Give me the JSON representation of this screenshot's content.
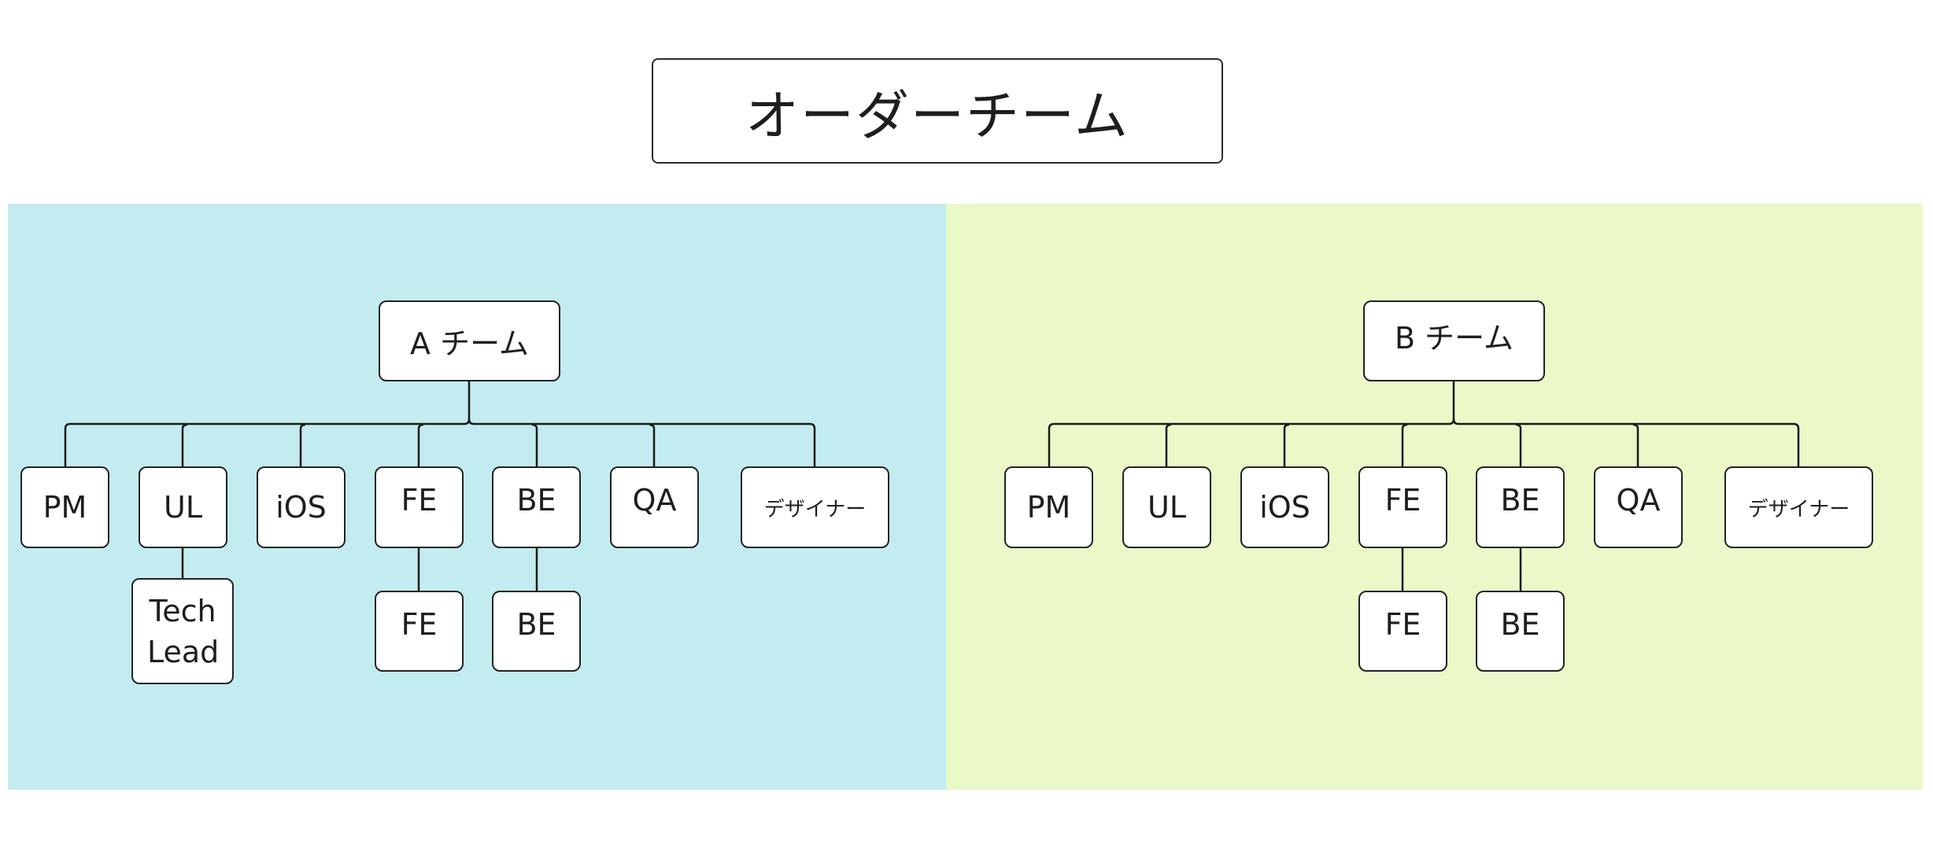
{
  "title": "オーダーチーム",
  "colors": {
    "team_a_bg": "#c3ecf0",
    "team_b_bg": "#ebf8c8",
    "node_border": "#222222",
    "line": "#1a1a1a"
  },
  "teams": [
    {
      "name": "A チーム",
      "members": [
        {
          "label": "PM"
        },
        {
          "label": "UL",
          "children": [
            "Tech Lead"
          ]
        },
        {
          "label": "iOS"
        },
        {
          "label": "FE",
          "children": [
            "FE"
          ]
        },
        {
          "label": "BE",
          "children": [
            "BE"
          ]
        },
        {
          "label": "QA"
        },
        {
          "label": "デザイナー"
        }
      ]
    },
    {
      "name": "B チーム",
      "members": [
        {
          "label": "PM"
        },
        {
          "label": "UL"
        },
        {
          "label": "iOS"
        },
        {
          "label": "FE",
          "children": [
            "FE"
          ]
        },
        {
          "label": "BE",
          "children": [
            "BE"
          ]
        },
        {
          "label": "QA"
        },
        {
          "label": "デザイナー"
        }
      ]
    }
  ]
}
